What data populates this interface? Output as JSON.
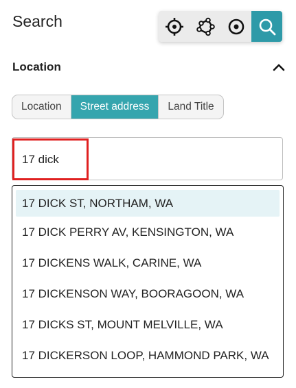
{
  "title": "Search",
  "toolbar": {
    "icons": [
      "crosshair-icon",
      "polygon-draw-icon",
      "target-icon",
      "search-icon"
    ],
    "accent": "#2e9aa8"
  },
  "section": {
    "title": "Location",
    "expanded": true
  },
  "tabs": {
    "items": [
      "Location",
      "Street address",
      "Land Title"
    ],
    "active": "Street address"
  },
  "search": {
    "value": "17 dick"
  },
  "suggestions": [
    "17 DICK ST, NORTHAM, WA",
    "17 DICK PERRY AV, KENSINGTON, WA",
    "17 DICKENS WALK, CARINE, WA",
    "17 DICKENSON WAY, BOORAGOON, WA",
    "17 DICKS ST, MOUNT MELVILLE, WA",
    "17 DICKERSON LOOP, HAMMOND PARK, WA"
  ]
}
